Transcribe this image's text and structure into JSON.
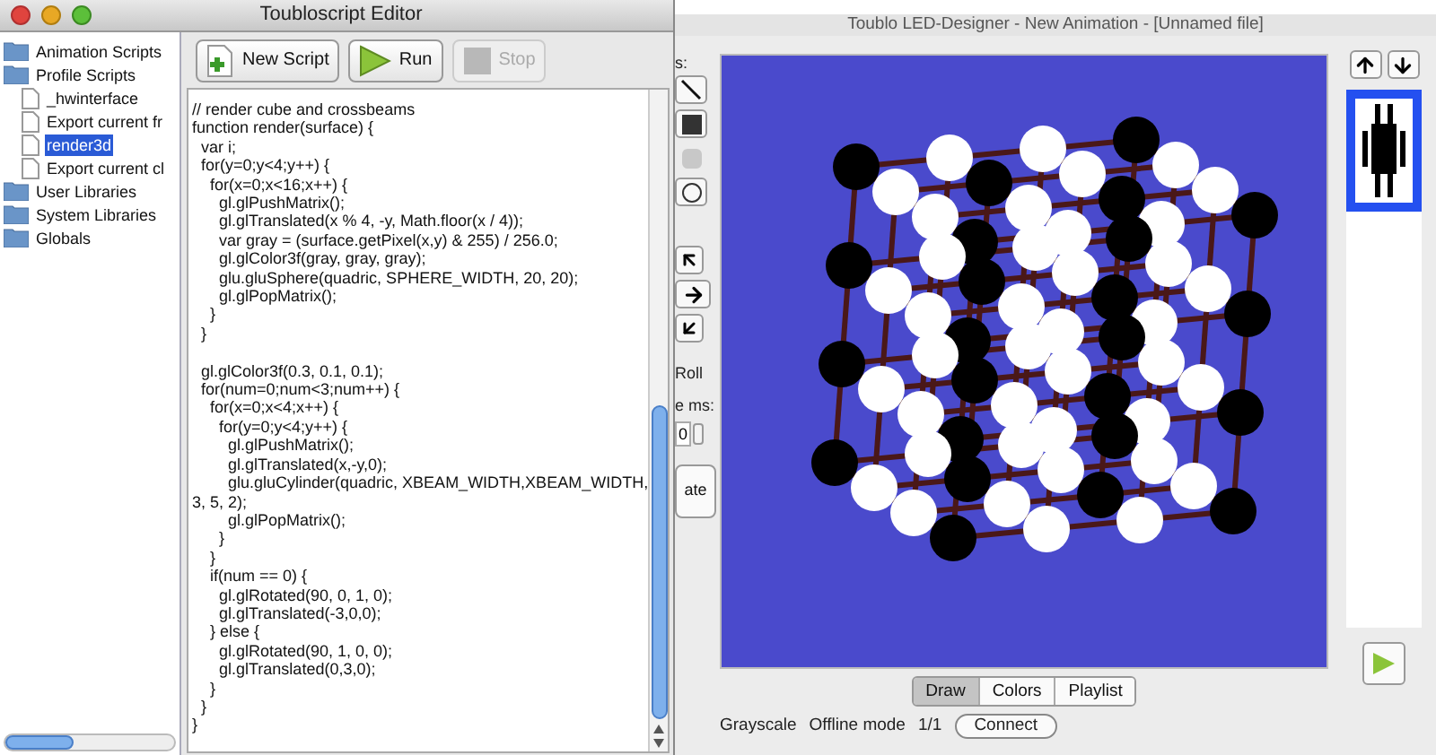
{
  "editor": {
    "title": "Toubloscript Editor",
    "tree": [
      {
        "label": "Animation Scripts",
        "kind": "folder",
        "selected": false
      },
      {
        "label": "Profile Scripts",
        "kind": "folder",
        "selected": false,
        "children": [
          {
            "label": "_hwinterface",
            "kind": "file",
            "selected": false
          },
          {
            "label": "Export current fr",
            "kind": "file",
            "selected": false
          },
          {
            "label": "render3d",
            "kind": "file",
            "selected": true
          },
          {
            "label": "Export current cl",
            "kind": "file",
            "selected": false
          }
        ]
      },
      {
        "label": "User Libraries",
        "kind": "folder",
        "selected": false
      },
      {
        "label": "System Libraries",
        "kind": "folder",
        "selected": false
      },
      {
        "label": "Globals",
        "kind": "folder",
        "selected": false
      }
    ],
    "toolbar": [
      {
        "label": "New Script",
        "kind": "new",
        "disabled": false
      },
      {
        "label": "Run",
        "kind": "run",
        "disabled": false
      },
      {
        "label": "Stop",
        "kind": "stop",
        "disabled": true
      }
    ],
    "code_blocks": [
      [
        "// render cube and crossbeams",
        "function render(surface) {",
        "  var i;",
        "  for(y=0;y<4;y++) {",
        "    for(x=0;x<16;x++) {",
        "      gl.glPushMatrix();",
        "      gl.glTranslated(x % 4, -y, Math.floor(x / 4));",
        "      var gray = (surface.getPixel(x,y) & 255) / 256.0;",
        "      gl.glColor3f(gray, gray, gray);",
        "      glu.gluSphere(quadric, SPHERE_WIDTH, 20, 20);",
        "      gl.glPopMatrix();",
        "    }",
        "  }"
      ],
      [
        "  gl.glColor3f(0.3, 0.1, 0.1);",
        "  for(num=0;num<3;num++) {",
        "    for(x=0;x<4;x++) {",
        "      for(y=0;y<4;y++) {",
        "        gl.glPushMatrix();",
        "        gl.glTranslated(x,-y,0);",
        "        glu.gluCylinder(quadric, XBEAM_WIDTH,XBEAM_WIDTH,",
        "3, 5, 2);",
        "        gl.glPopMatrix();",
        "      }",
        "    }",
        "    if(num == 0) {",
        "      gl.glRotated(90, 0, 1, 0);",
        "      gl.glTranslated(-3,0,0);",
        "    } else {",
        "      gl.glRotated(90, 1, 0, 0);",
        "      gl.glTranslated(0,3,0);",
        "    }",
        "  }",
        "}"
      ]
    ]
  },
  "designer": {
    "title": "Toublo LED-Designer - New Animation - [Unnamed file]",
    "side_labels": [
      "s:",
      "Roll",
      "e ms:"
    ],
    "spinner_value": "0",
    "side_button": "ate",
    "tabs": [
      {
        "label": "Draw",
        "selected": true
      },
      {
        "label": "Colors",
        "selected": false
      },
      {
        "label": "Playlist",
        "selected": false
      }
    ],
    "status": {
      "mode": "Grayscale",
      "connection": "Offline mode",
      "frame": "1/1",
      "button": "Connect"
    }
  }
}
